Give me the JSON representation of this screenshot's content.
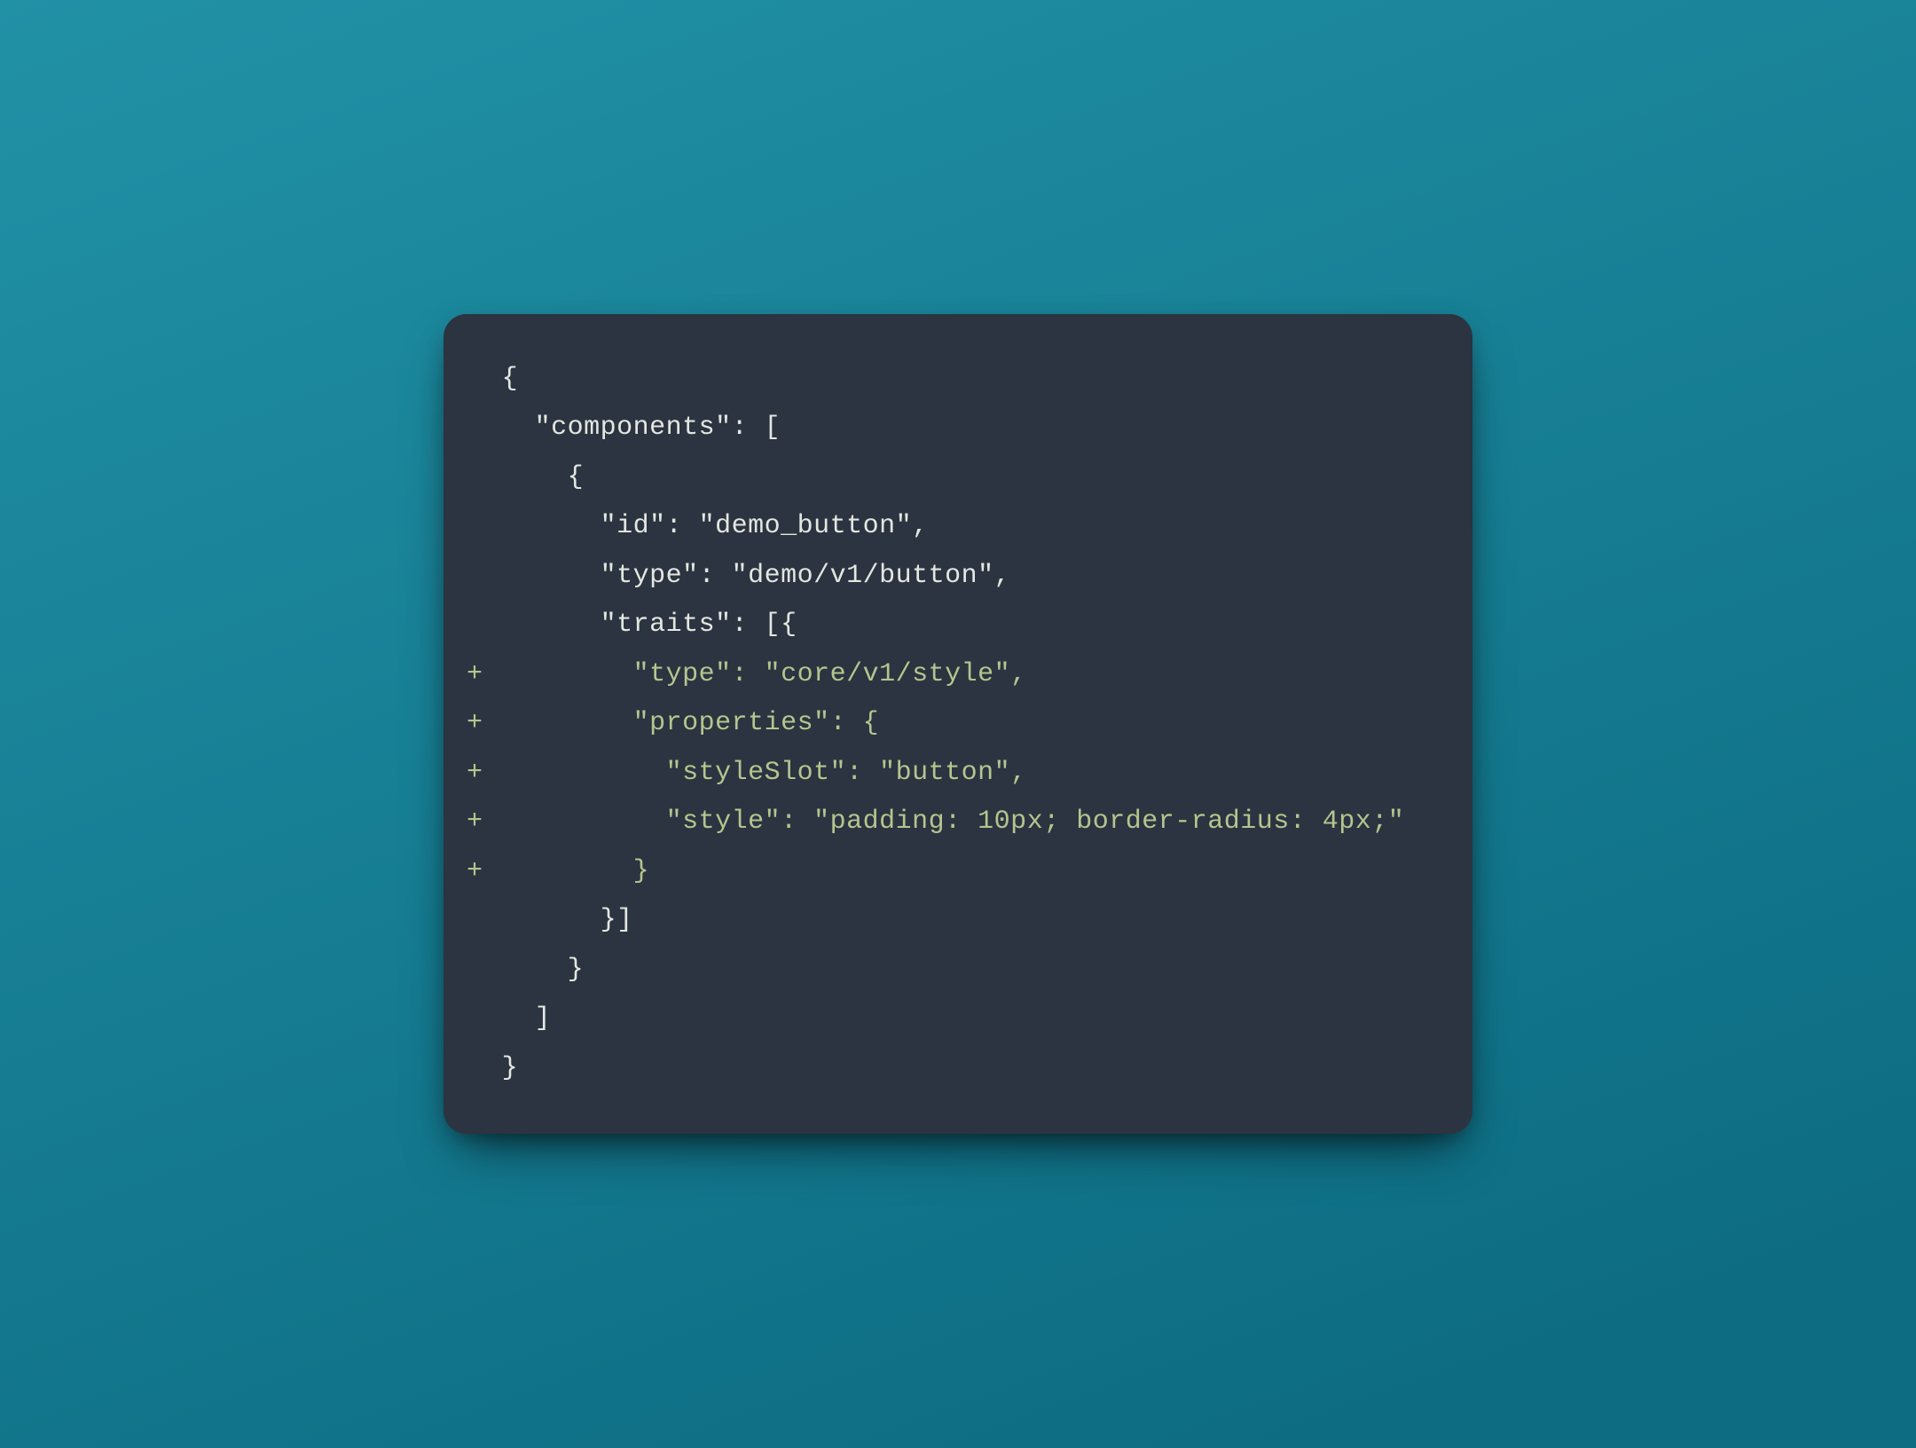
{
  "code": {
    "lines": [
      {
        "marker": "",
        "text": "{",
        "added": false
      },
      {
        "marker": "",
        "text": "  \"components\": [",
        "added": false
      },
      {
        "marker": "",
        "text": "    {",
        "added": false
      },
      {
        "marker": "",
        "text": "      \"id\": \"demo_button\",",
        "added": false
      },
      {
        "marker": "",
        "text": "      \"type\": \"demo/v1/button\",",
        "added": false
      },
      {
        "marker": "",
        "text": "      \"traits\": [{",
        "added": false
      },
      {
        "marker": "+",
        "text": "        \"type\": \"core/v1/style\",",
        "added": true
      },
      {
        "marker": "+",
        "text": "        \"properties\": {",
        "added": true
      },
      {
        "marker": "+",
        "text": "          \"styleSlot\": \"button\",",
        "added": true
      },
      {
        "marker": "+",
        "text": "          \"style\": \"padding: 10px; border-radius: 4px;\"",
        "added": true
      },
      {
        "marker": "+",
        "text": "        }",
        "added": true
      },
      {
        "marker": "",
        "text": "      }]",
        "added": false
      },
      {
        "marker": "",
        "text": "    }",
        "added": false
      },
      {
        "marker": "",
        "text": "  ]",
        "added": false
      },
      {
        "marker": "",
        "text": "}",
        "added": false
      }
    ]
  }
}
